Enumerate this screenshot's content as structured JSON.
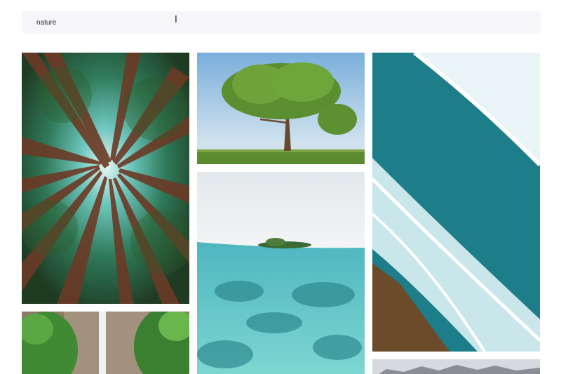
{
  "search": {
    "value": "nature",
    "icon": "text-cursor-icon"
  },
  "gallery": {
    "photos": [
      {
        "name": "redwood-forest-photo",
        "subject": "redwood-forest"
      },
      {
        "name": "waterfall-photo",
        "subject": "waterfall"
      },
      {
        "name": "lone-tree-photo",
        "subject": "lone-tree"
      },
      {
        "name": "underwater-island-photo",
        "subject": "underwater-island"
      },
      {
        "name": "ocean-waves-aerial-photo",
        "subject": "ocean-waves"
      },
      {
        "name": "mountain-range-photo",
        "subject": "mountains"
      }
    ]
  },
  "colors": {
    "search_background": "#f6f5fa",
    "page_background": "#ffffff"
  }
}
